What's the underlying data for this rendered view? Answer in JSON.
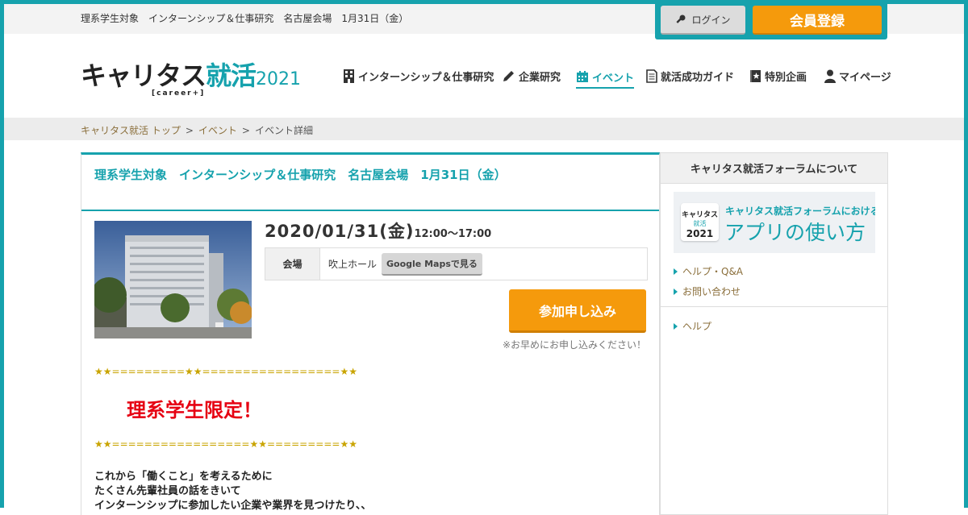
{
  "topbar": {
    "event_caption": "理系学生対象　インターンシップ＆仕事研究　名古屋会場　1月31日（金）",
    "login_label": "ログイン",
    "register_label": "会員登録"
  },
  "logo": {
    "part1": "キャリタス",
    "part2": "就活",
    "year": "2021",
    "sub": "[career+]"
  },
  "nav": {
    "items": [
      {
        "label": "インターンシップ＆仕事研究",
        "icon": "building-icon"
      },
      {
        "label": "企業研究",
        "icon": "pencil-icon"
      },
      {
        "label": "イベント",
        "icon": "calendar-icon",
        "active": true
      },
      {
        "label": "就活成功ガイド",
        "icon": "document-icon"
      },
      {
        "label": "特別企画",
        "icon": "star-book-icon"
      },
      {
        "label": "マイページ",
        "icon": "person-icon"
      }
    ]
  },
  "breadcrumb": {
    "home": "キャリタス就活 トップ",
    "events": "イベント",
    "current": "イベント詳細",
    "separator": ">"
  },
  "event": {
    "title": "理系学生対象　インターンシップ＆仕事研究　名古屋会場　1月31日（金）",
    "date": "2020/01/31(金)",
    "time": "12:00～17:00",
    "venue_label": "会場",
    "venue_value": "吹上ホール",
    "maps_label": "Google Mapsで見る",
    "apply_label": "参加申し込み",
    "apply_note": "※お早めにお申し込みください！",
    "deco_top": "★★=========★★=================★★",
    "limited": "理系学生限定！",
    "deco_bottom": "★★=================★★=========★★",
    "body_lines": [
      "これから「働くこと」を考えるために",
      "たくさん先輩社員の話をきいて",
      "インターンシップに参加したい企業や業界を見つけたり、、"
    ]
  },
  "sidebar": {
    "heading": "キャリタス就活フォーラムについて",
    "banner": {
      "logo_line1": "キャリタス",
      "logo_line2": "就活",
      "logo_line3": "2021",
      "line1": "キャリタス就活フォーラムにおける",
      "line2": "アプリの使い方"
    },
    "links": [
      "ヘルプ・Q&A",
      "お問い合わせ"
    ],
    "help_link": "ヘルプ"
  },
  "colors": {
    "accent": "#16a2ad",
    "cta": "#f59a0c",
    "alert": "#e60012",
    "gold": "#c9a400"
  }
}
